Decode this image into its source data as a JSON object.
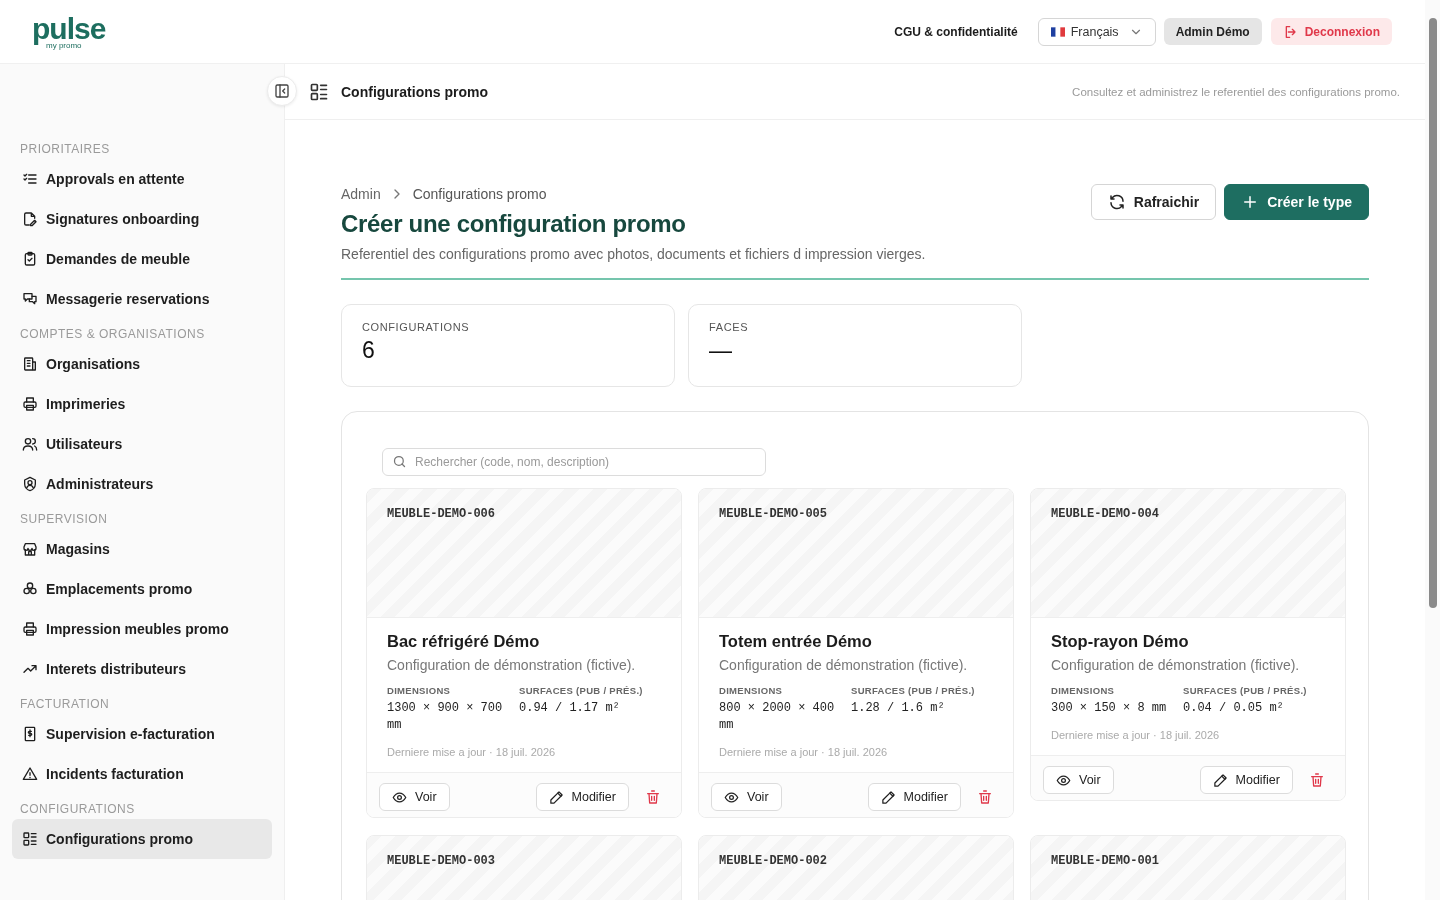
{
  "brand": {
    "name": "pulse",
    "tagline": "my promo"
  },
  "header": {
    "links": [
      "CGU & confidentialité"
    ],
    "language": {
      "value": "Français"
    },
    "user": "Admin Démo",
    "logout": "Deconnexion"
  },
  "sidebar": {
    "sections": [
      {
        "title": "PRIORITAIRES",
        "items": [
          {
            "label": "Approvals en attente",
            "selected": false
          },
          {
            "label": "Signatures onboarding",
            "selected": false
          },
          {
            "label": "Demandes de meuble",
            "selected": false
          },
          {
            "label": "Messagerie reservations",
            "selected": false
          }
        ]
      },
      {
        "title": "COMPTES & ORGANISATIONS",
        "items": [
          {
            "label": "Organisations",
            "selected": false
          },
          {
            "label": "Imprimeries",
            "selected": false
          },
          {
            "label": "Utilisateurs",
            "selected": false
          },
          {
            "label": "Administrateurs",
            "selected": false
          }
        ]
      },
      {
        "title": "SUPERVISION",
        "items": [
          {
            "label": "Magasins",
            "selected": false
          },
          {
            "label": "Emplacements promo",
            "selected": false
          },
          {
            "label": "Impression meubles promo",
            "selected": false
          },
          {
            "label": "Interets distributeurs",
            "selected": false
          }
        ]
      },
      {
        "title": "FACTURATION",
        "items": [
          {
            "label": "Supervision e-facturation",
            "selected": false
          },
          {
            "label": "Incidents facturation",
            "selected": false
          }
        ]
      },
      {
        "title": "CONFIGURATIONS",
        "items": [
          {
            "label": "Configurations promo",
            "selected": true
          }
        ]
      }
    ]
  },
  "topbar": {
    "title": "Configurations promo",
    "hint": "Consultez et administrez le referentiel des configurations promo."
  },
  "breadcrumb": [
    "Admin",
    "Configurations promo"
  ],
  "page": {
    "title": "Créer une configuration promo",
    "subtitle": "Referentiel des configurations promo avec photos, documents et fichiers d impression vierges.",
    "actions": [
      {
        "label": "Rafraichir",
        "kind": "refresh"
      },
      {
        "label": "Créer le type",
        "kind": "create"
      }
    ]
  },
  "stats": [
    {
      "label": "CONFIGURATIONS",
      "value": "6"
    },
    {
      "label": "FACES",
      "value": "—"
    }
  ],
  "search": {
    "placeholder": "Rechercher (code, nom, description)"
  },
  "cards": [
    {
      "code": "MEUBLE-DEMO-006",
      "title": "Bac réfrigéré Démo",
      "description": "Configuration de démonstration (fictive).",
      "specs": [
        {
          "label": "DIMENSIONS",
          "value": "1300 × 900 × 700 mm"
        },
        {
          "label": "SURFACES (PUB / PRÉS.)",
          "value": "0.94 / 1.17 m²"
        }
      ],
      "updated": "Derniere mise a jour · 18 juil. 2026",
      "view": "Voir",
      "edit": "Modifier"
    },
    {
      "code": "MEUBLE-DEMO-005",
      "title": "Totem entrée Démo",
      "description": "Configuration de démonstration (fictive).",
      "specs": [
        {
          "label": "DIMENSIONS",
          "value": "800 × 2000 × 400 mm"
        },
        {
          "label": "SURFACES (PUB / PRÉS.)",
          "value": "1.28 / 1.6 m²"
        }
      ],
      "updated": "Derniere mise a jour · 18 juil. 2026",
      "view": "Voir",
      "edit": "Modifier"
    },
    {
      "code": "MEUBLE-DEMO-004",
      "title": "Stop-rayon Démo",
      "description": "Configuration de démonstration (fictive).",
      "specs": [
        {
          "label": "DIMENSIONS",
          "value": "300 × 150 × 8 mm"
        },
        {
          "label": "SURFACES (PUB / PRÉS.)",
          "value": "0.04 / 0.05 m²"
        }
      ],
      "updated": "Derniere mise a jour · 18 juil. 2026",
      "view": "Voir",
      "edit": "Modifier"
    },
    {
      "code": "MEUBLE-DEMO-003"
    },
    {
      "code": "MEUBLE-DEMO-002"
    },
    {
      "code": "MEUBLE-DEMO-001"
    }
  ]
}
